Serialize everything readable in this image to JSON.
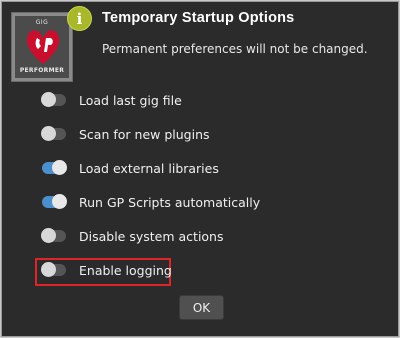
{
  "dialog": {
    "title": "Temporary Startup Options",
    "subtitle": "Permanent preferences will not be changed.",
    "info_badge": "i",
    "logo": {
      "top_text": "GIG",
      "bottom_text": "PERFORMER"
    }
  },
  "options": [
    {
      "label": "Load last gig file",
      "enabled": false
    },
    {
      "label": "Scan for new plugins",
      "enabled": false
    },
    {
      "label": "Load external libraries",
      "enabled": true
    },
    {
      "label": "Run GP Scripts automatically",
      "enabled": true
    },
    {
      "label": "Disable system actions",
      "enabled": false
    },
    {
      "label": "Enable logging",
      "enabled": false,
      "highlighted": true
    }
  ],
  "buttons": {
    "ok_label": "OK"
  },
  "colors": {
    "background": "#2b2b2b",
    "toggle_on": "#4c8fcd",
    "toggle_off": "#555555",
    "highlight": "#e0252a",
    "info_badge": "#a8b82a"
  }
}
